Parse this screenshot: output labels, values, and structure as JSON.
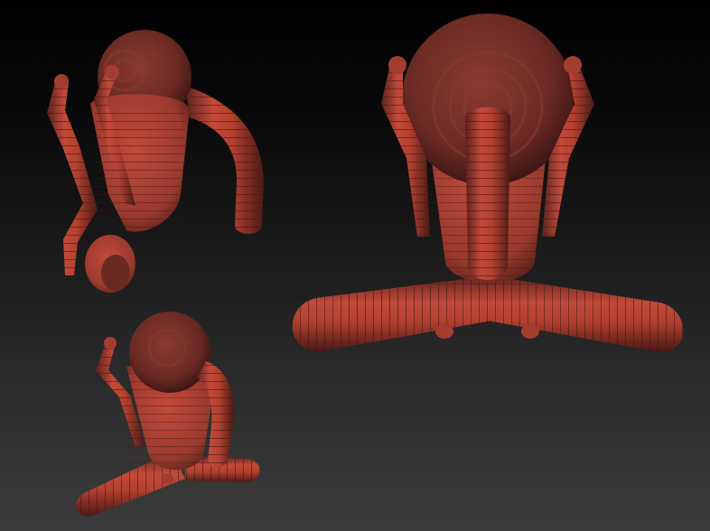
{
  "scene": {
    "kind": "3d-sculpt-viewport",
    "background_top": "#000000",
    "background_bottom": "#3c3c3c",
    "material_colors": {
      "light": "#c24a3a",
      "mid": "#a33d30",
      "dark": "#6a2a24",
      "shadow": "#3f1714"
    },
    "models": [
      {
        "name": "figure-side-view"
      },
      {
        "name": "figure-front-view"
      },
      {
        "name": "figure-three-quarter-view"
      }
    ]
  }
}
